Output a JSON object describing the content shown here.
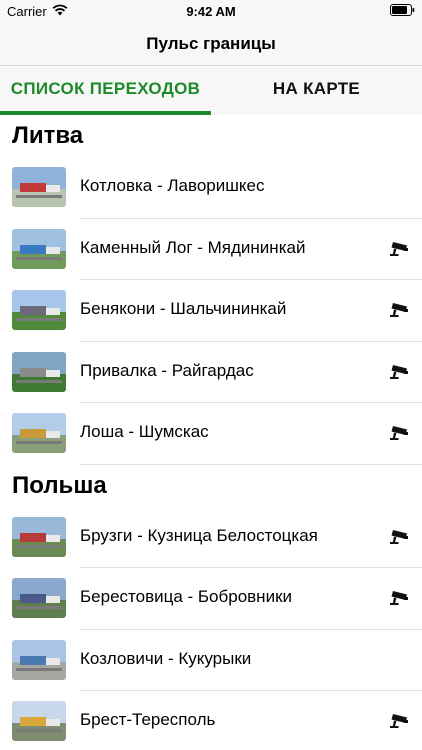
{
  "status_bar": {
    "carrier": "Carrier",
    "time": "9:42 AM"
  },
  "nav": {
    "title": "Пульс границы"
  },
  "tabs": [
    {
      "label": "СПИСОК ПЕРЕХОДОВ",
      "active": true
    },
    {
      "label": "НА КАРТЕ",
      "active": false
    }
  ],
  "accent_color": "#1e8a2a",
  "sections": [
    {
      "title": "Литва",
      "items": [
        {
          "name": "Котловка - Лаворишкес",
          "camera": false
        },
        {
          "name": "Каменный Лог - Мядининкай",
          "camera": true
        },
        {
          "name": "Бенякони - Шальчининкай",
          "camera": true
        },
        {
          "name": "Привалка - Райгардас",
          "camera": true
        },
        {
          "name": "Лоша - Шумскас",
          "camera": true
        }
      ]
    },
    {
      "title": "Польша",
      "items": [
        {
          "name": "Брузги - Кузница Белостоцкая",
          "camera": true
        },
        {
          "name": "Берестовица - Бобровники",
          "camera": true
        },
        {
          "name": "Козловичи - Кукурыки",
          "camera": false
        },
        {
          "name": "Брест-Тересполь",
          "camera": true
        }
      ]
    }
  ]
}
